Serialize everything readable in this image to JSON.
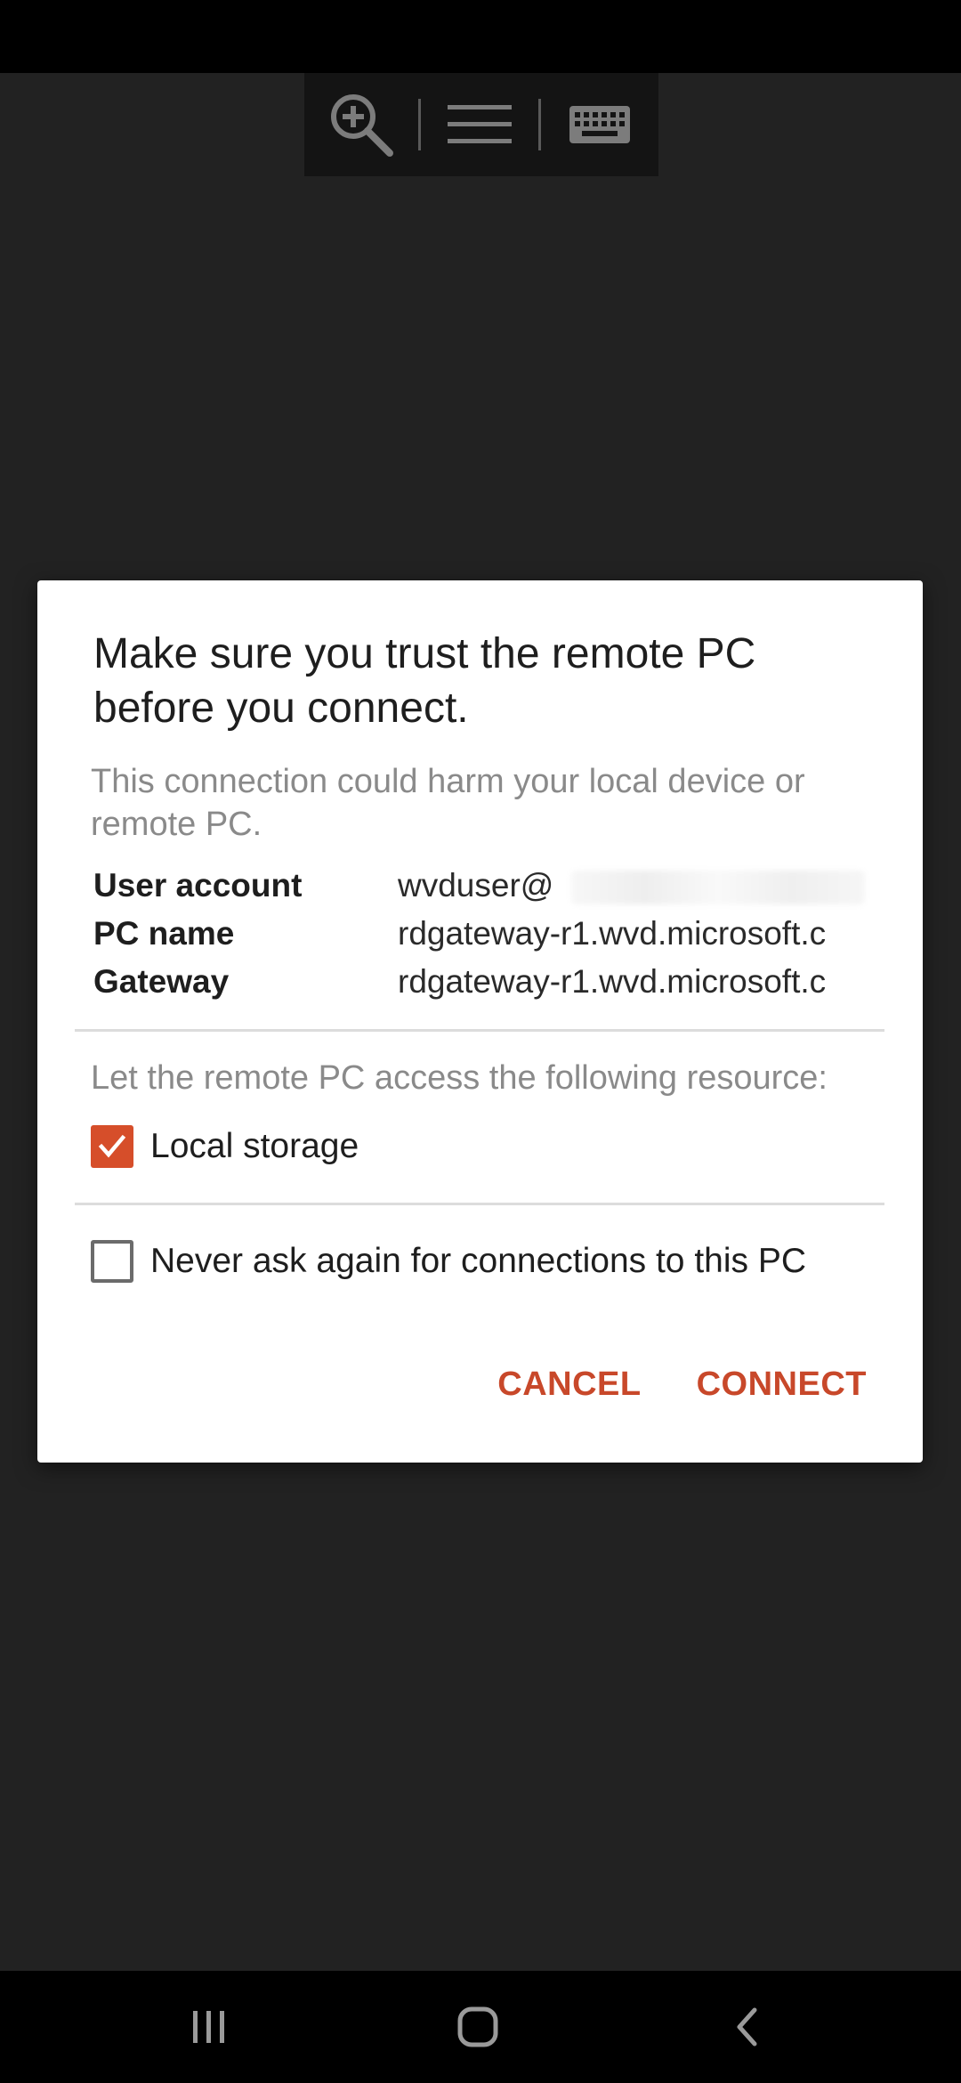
{
  "toolbar": {
    "zoom_icon": "zoom-in-icon",
    "menu_icon": "hamburger-menu-icon",
    "keyboard_icon": "keyboard-icon"
  },
  "dialog": {
    "title": "Make sure you trust the remote PC before you connect.",
    "warning": "This connection could harm your local device or remote PC.",
    "info_rows": [
      {
        "key": "User account",
        "value": "wvduser@"
      },
      {
        "key": "PC name",
        "value": "rdgateway-r1.wvd.microsoft.c"
      },
      {
        "key": "Gateway",
        "value": "rdgateway-r1.wvd.microsoft.c"
      }
    ],
    "resource_prompt": "Let the remote PC access the following resource:",
    "local_storage": {
      "label": "Local storage",
      "checked": true
    },
    "never_ask": {
      "label": "Never ask again for connections to this PC",
      "checked": false
    },
    "cancel_label": "CANCEL",
    "connect_label": "CONNECT"
  },
  "colors": {
    "accent": "#d64e2a",
    "button_text": "#c8482a",
    "background": "#222222",
    "dialog": "#ffffff"
  },
  "navbar": {
    "recents_icon": "recents-icon",
    "home_icon": "home-icon",
    "back_icon": "back-icon"
  }
}
